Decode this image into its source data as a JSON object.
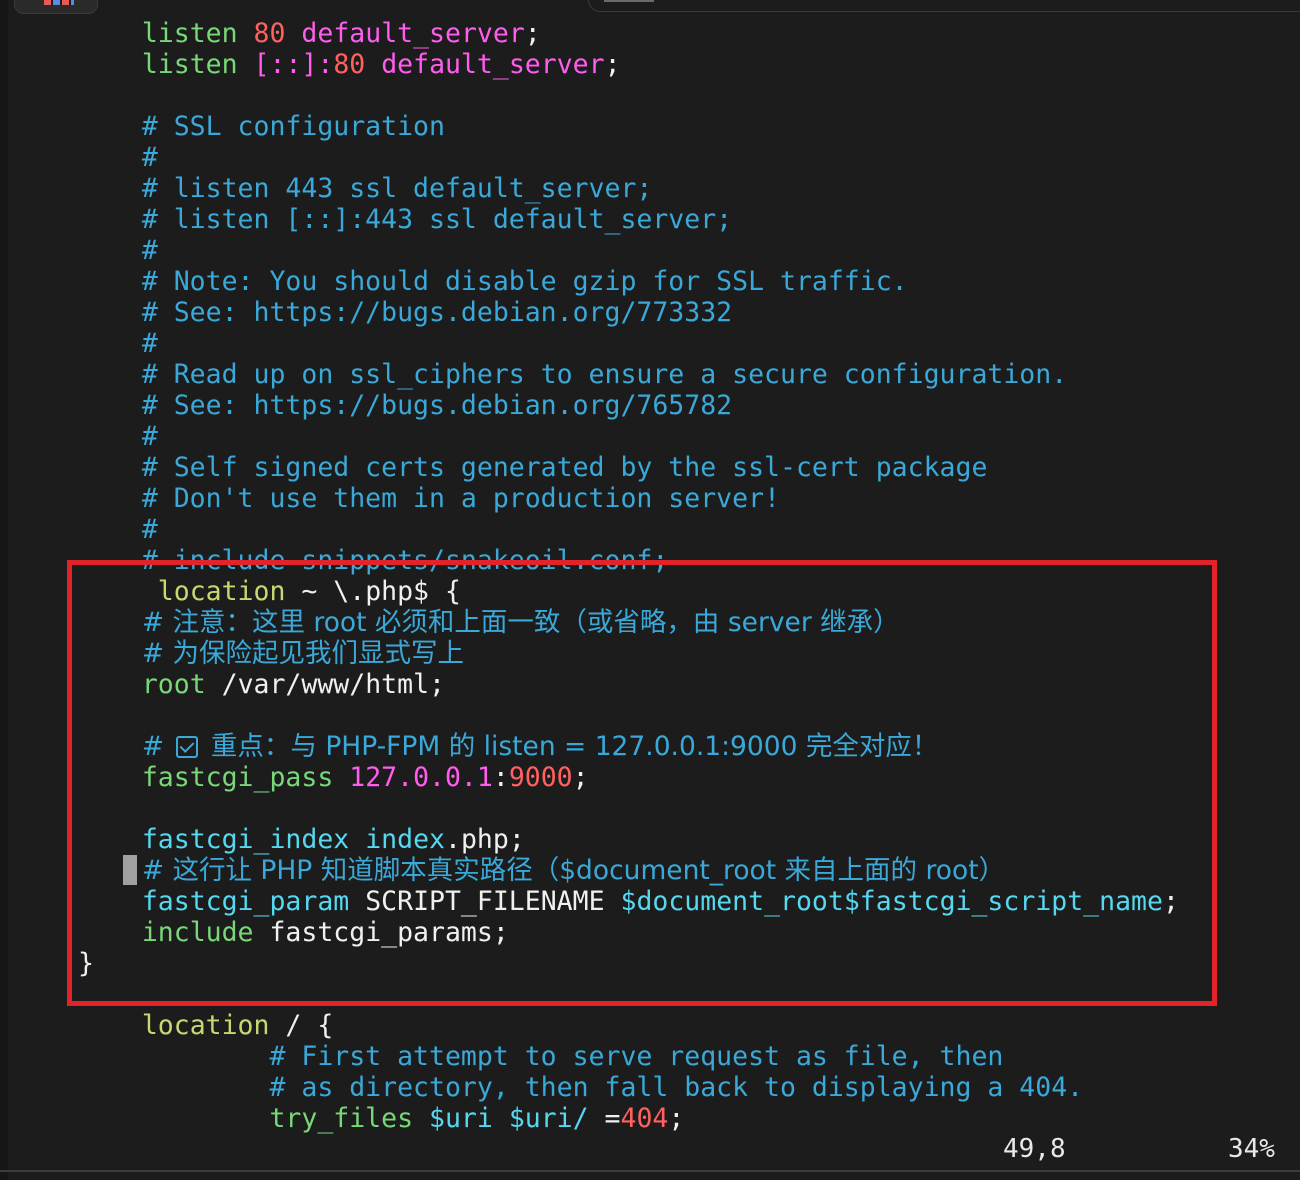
{
  "editor": {
    "lines": [
      {
        "parts": [
          [
            "    ",
            ""
          ],
          [
            "listen",
            "dir"
          ],
          [
            " ",
            ""
          ],
          [
            "80",
            "num"
          ],
          [
            " ",
            ""
          ],
          [
            "default_server",
            "mag"
          ],
          [
            ";",
            "wh"
          ]
        ]
      },
      {
        "parts": [
          [
            "    ",
            ""
          ],
          [
            "listen",
            "dir"
          ],
          [
            " ",
            ""
          ],
          [
            "[::]:",
            "mag"
          ],
          [
            "80",
            "num"
          ],
          [
            " ",
            ""
          ],
          [
            "default_server",
            "mag"
          ],
          [
            ";",
            "wh"
          ]
        ]
      },
      {
        "parts": [
          [
            "",
            ""
          ]
        ]
      },
      {
        "parts": [
          [
            "    # SSL configuration",
            "cm"
          ]
        ]
      },
      {
        "parts": [
          [
            "    #",
            "cm"
          ]
        ]
      },
      {
        "parts": [
          [
            "    # listen 443 ssl default_server;",
            "cm"
          ]
        ]
      },
      {
        "parts": [
          [
            "    # listen [::]:443 ssl default_server;",
            "cm"
          ]
        ]
      },
      {
        "parts": [
          [
            "    #",
            "cm"
          ]
        ]
      },
      {
        "parts": [
          [
            "    # Note: You should disable gzip for SSL traffic.",
            "cm"
          ]
        ]
      },
      {
        "parts": [
          [
            "    # See: https://bugs.debian.org/773332",
            "cm"
          ]
        ]
      },
      {
        "parts": [
          [
            "    #",
            "cm"
          ]
        ]
      },
      {
        "parts": [
          [
            "    # Read up on ssl_ciphers to ensure a secure configuration.",
            "cm"
          ]
        ]
      },
      {
        "parts": [
          [
            "    # See: https://bugs.debian.org/765782",
            "cm"
          ]
        ]
      },
      {
        "parts": [
          [
            "    #",
            "cm"
          ]
        ]
      },
      {
        "parts": [
          [
            "    # Self signed certs generated by the ssl-cert package",
            "cm"
          ]
        ]
      },
      {
        "parts": [
          [
            "    # Don't use them in a production server!",
            "cm"
          ]
        ]
      },
      {
        "parts": [
          [
            "    #",
            "cm"
          ]
        ]
      },
      {
        "parts": [
          [
            "    # include snippets/snakeoil.conf;",
            "cm"
          ]
        ]
      },
      {
        "parts": [
          [
            "     ",
            ""
          ],
          [
            "location",
            "kw"
          ],
          [
            " ~ \\.php$ {",
            "wh"
          ]
        ]
      },
      {
        "parts": [
          [
            "    ",
            ""
          ],
          [
            "# 注意：这里 root 必须和上面一致（或省略，由 server 继承）",
            "cmz"
          ]
        ]
      },
      {
        "parts": [
          [
            "    ",
            ""
          ],
          [
            "# 为保险起见我们显式写上",
            "cmz"
          ]
        ]
      },
      {
        "parts": [
          [
            "    ",
            ""
          ],
          [
            "root",
            "dir"
          ],
          [
            " /var/www/html;",
            "wh"
          ]
        ]
      },
      {
        "parts": [
          [
            "",
            ""
          ]
        ]
      },
      {
        "parts": [
          [
            "    ",
            ""
          ],
          [
            "# ",
            "cmz"
          ],
          [
            "CHECK",
            "chk"
          ],
          [
            " 重点：与 PHP-FPM 的 listen = 127.0.0.1:9000 完全对应！",
            "cmz"
          ]
        ]
      },
      {
        "parts": [
          [
            "    ",
            ""
          ],
          [
            "fastcgi_pass",
            "dir"
          ],
          [
            " ",
            ""
          ],
          [
            "127.0.0.1",
            "mag"
          ],
          [
            ":",
            "wh"
          ],
          [
            "9000",
            "num"
          ],
          [
            ";",
            "wh"
          ]
        ]
      },
      {
        "parts": [
          [
            "",
            ""
          ]
        ]
      },
      {
        "parts": [
          [
            "    ",
            ""
          ],
          [
            "fastcgi_index",
            "cyan"
          ],
          [
            " ",
            ""
          ],
          [
            "index",
            "cyan"
          ],
          [
            ".php;",
            "wh"
          ]
        ]
      },
      {
        "parts": [
          [
            "    ",
            ""
          ],
          [
            "# 这行让 PHP 知道脚本真实路径（$document_root 来自上面的 root）",
            "cmz"
          ]
        ]
      },
      {
        "parts": [
          [
            "    ",
            ""
          ],
          [
            "fastcgi_param",
            "cyan"
          ],
          [
            " SCRIPT_FILENAME ",
            "wh"
          ],
          [
            "$document_root$fastcgi_script_name",
            "cyan"
          ],
          [
            ";",
            "wh"
          ]
        ]
      },
      {
        "parts": [
          [
            "    ",
            ""
          ],
          [
            "include",
            "dir"
          ],
          [
            " fastcgi_params;",
            "wh"
          ]
        ]
      },
      {
        "parts": [
          [
            "}",
            "wh"
          ]
        ]
      },
      {
        "parts": [
          [
            "",
            ""
          ]
        ]
      },
      {
        "parts": [
          [
            "    ",
            ""
          ],
          [
            "location",
            "kw"
          ],
          [
            " / {",
            "wh"
          ]
        ]
      },
      {
        "parts": [
          [
            "            # First attempt to serve request as file, then",
            "cm"
          ]
        ]
      },
      {
        "parts": [
          [
            "            # as directory, then fall back to displaying a 404.",
            "cm"
          ]
        ]
      },
      {
        "parts": [
          [
            "            ",
            ""
          ],
          [
            "try_files",
            "dir"
          ],
          [
            " ",
            ""
          ],
          [
            "$uri",
            "cyan"
          ],
          [
            " ",
            ""
          ],
          [
            "$uri/",
            "cyan"
          ],
          [
            " =",
            "wh"
          ],
          [
            "404",
            "num"
          ],
          [
            ";",
            "wh"
          ]
        ]
      }
    ]
  },
  "status": {
    "position": "49,8",
    "percent": "34%"
  }
}
